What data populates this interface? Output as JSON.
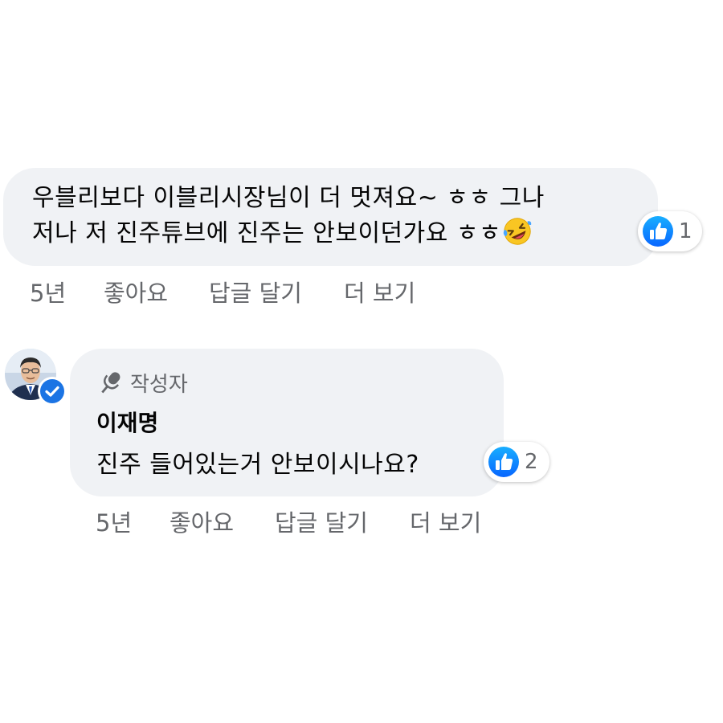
{
  "comment": {
    "lines": [
      "우블리보다 이블리시장님이 더 멋져요~ ㅎㅎ 그나",
      "저나 저 진주튜브에 진주는 안보이던가요 ㅎㅎ"
    ],
    "emoji_icon": "rolling-on-floor-laughing-emoji",
    "reaction_icon": "like-icon",
    "reaction_count": "1",
    "actions": {
      "time": "5년",
      "like": "좋아요",
      "reply": "답글 달기",
      "more": "더 보기"
    }
  },
  "reply": {
    "badge": "작성자",
    "badge_icon": "microphone-icon",
    "author": "이재명",
    "text": "진주 들어있는거 안보이시나요?",
    "reaction_icon": "like-icon",
    "reaction_count": "2",
    "verified_icon": "verified-check-icon",
    "actions": {
      "time": "5년",
      "like": "좋아요",
      "reply": "답글 달기",
      "more": "더 보기"
    }
  },
  "colors": {
    "bubble": "#f0f2f5",
    "meta_text": "#65676b",
    "like_blue": "#1877f2"
  }
}
